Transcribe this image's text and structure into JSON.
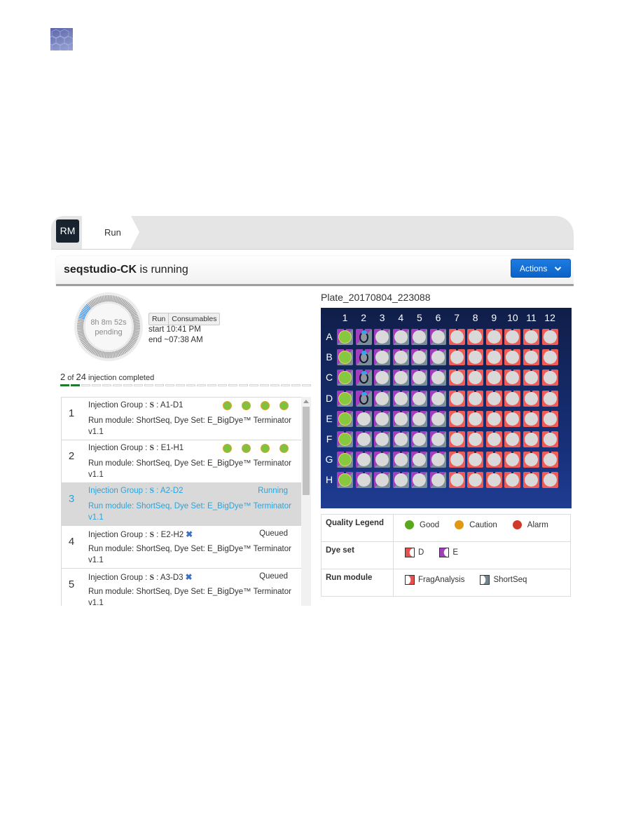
{
  "logo": {
    "icon": "hexagon-pattern-logo-icon"
  },
  "breadcrumb": {
    "badge": "RM",
    "tab": "Run"
  },
  "header": {
    "instrument": "seqstudio-CK",
    "status": " is running",
    "actions_label": "Actions",
    "actions_icon": "chevron-down-icon"
  },
  "timer": {
    "remaining": "8h 8m 52s",
    "state": "pending",
    "progress_fraction": 0.08
  },
  "tabs": [
    "Run",
    "Consumables"
  ],
  "times": {
    "start": "start 10:41 PM",
    "end": "end ~07:38 AM"
  },
  "injections": {
    "completed": "2",
    "total": "24",
    "of_label": " of ",
    "suffix": " injection completed",
    "completed_count": 2,
    "total_count": 24
  },
  "injection_list": [
    {
      "num": "1",
      "prefix": "Injection Group : ",
      "s": "S",
      "range": " : A1-D1",
      "module": "Run module: ShortSeq, Dye Set: E_BigDye™ Terminator v1.1",
      "status": "",
      "dots": 4,
      "removable": false,
      "active": false
    },
    {
      "num": "2",
      "prefix": "Injection Group : ",
      "s": "S",
      "range": " : E1-H1",
      "module": "Run module: ShortSeq, Dye Set: E_BigDye™ Terminator v1.1",
      "status": "",
      "dots": 4,
      "removable": false,
      "active": false
    },
    {
      "num": "3",
      "prefix": "Injection Group : ",
      "s": "S",
      "range": " : A2-D2",
      "module": "Run module: ShortSeq, Dye Set: E_BigDye™ Terminator v1.1",
      "status": "Running",
      "dots": 0,
      "removable": false,
      "active": true
    },
    {
      "num": "4",
      "prefix": "Injection Group : ",
      "s": "S",
      "range": " : E2-H2",
      "module": "Run module: ShortSeq, Dye Set: E_BigDye™ Terminator v1.1",
      "status": "Queued",
      "dots": 0,
      "removable": true,
      "active": false
    },
    {
      "num": "5",
      "prefix": "Injection Group : ",
      "s": "S",
      "range": " : A3-D3",
      "module": "Run module: ShortSeq, Dye Set: E_BigDye™ Terminator v1.1",
      "status": "Queued",
      "dots": 0,
      "removable": true,
      "active": false
    }
  ],
  "remove_glyph": "✖",
  "plate": {
    "name": "Plate_20170804_223088",
    "columns": [
      "1",
      "2",
      "3",
      "4",
      "5",
      "6",
      "7",
      "8",
      "9",
      "10",
      "11",
      "12"
    ],
    "rows": [
      "A",
      "B",
      "C",
      "D",
      "E",
      "F",
      "G",
      "H"
    ],
    "column_dye_set": [
      "E",
      "E",
      "E",
      "E",
      "E",
      "E",
      "D",
      "D",
      "D",
      "D",
      "D",
      "D"
    ],
    "well_state_notes": "Column 1 all good; A2-D2 running; rest pending",
    "good_wells": [
      "A1",
      "B1",
      "C1",
      "D1",
      "E1",
      "F1",
      "G1",
      "H1"
    ],
    "running_wells": [
      "A2",
      "B2",
      "C2",
      "D2"
    ]
  },
  "legend": {
    "quality_label": "Quality Legend",
    "quality": [
      {
        "label": "Good",
        "color": "#5aa820"
      },
      {
        "label": "Caution",
        "color": "#e09a10"
      },
      {
        "label": "Alarm",
        "color": "#d03a2a"
      }
    ],
    "dye_label": "Dye set",
    "dyes": [
      {
        "label": "D",
        "color": "#e8504e"
      },
      {
        "label": "E",
        "color": "#a040b8"
      }
    ],
    "module_label": "Run module",
    "modules": [
      {
        "label": "FragAnalysis",
        "color": "#e8504e"
      },
      {
        "label": "ShortSeq",
        "color": "#6f8590"
      }
    ]
  },
  "colors": {
    "accent_blue": "#0a63c8",
    "running_text": "#2aa3dc",
    "plate_bg": "#17307a",
    "dye_D": "#ef5b57",
    "dye_E": "#a33fbf",
    "shortseq": "#7a8e99"
  }
}
